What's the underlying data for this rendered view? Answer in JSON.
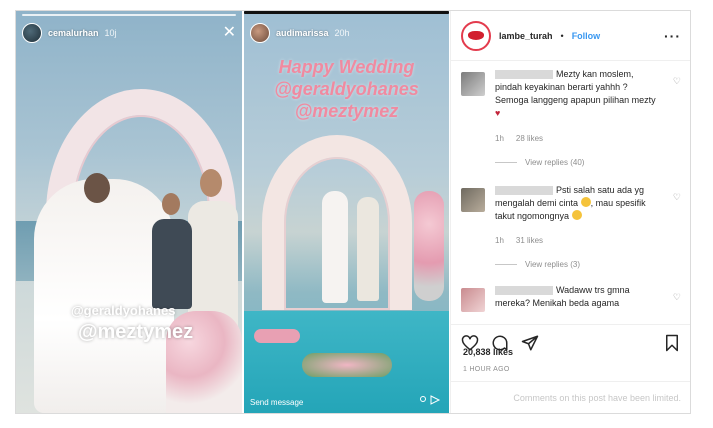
{
  "story_left": {
    "username": "cemalurhan",
    "time": "10j",
    "close_glyph": "✕",
    "tag_handle_1": "@geraldyohanes",
    "tag_handle_2": "@meztymez"
  },
  "story_right": {
    "username": "audimarissa",
    "time": "20h",
    "overlay_line_1": "Happy Wedding",
    "overlay_line_2": "@geraldyohanes",
    "overlay_line_3": "@meztymez",
    "send_message": "Send message"
  },
  "post": {
    "username": "lambe_turah",
    "separator": "•",
    "follow": "Follow",
    "more": "···",
    "comments": [
      {
        "text": "Mezty kan moslem, pindah keyakinan berarti yahhh ? Semoga langgeng apapun pilihan mezty",
        "heart": "♥",
        "time": "1h",
        "likes": "28 likes",
        "replies": "View replies (40)"
      },
      {
        "text": "Psti salah satu ada yg mengalah demi cinta",
        "text_2": ", mau spesifik takut ngomongnya",
        "time": "1h",
        "likes": "31 likes",
        "replies": "View replies (3)"
      },
      {
        "text": "Wadaww trs gmna mereka? Menikah beda agama"
      }
    ],
    "likes": "20,838 likes",
    "ago": "1 HOUR AGO",
    "limited": "Comments on this post have been limited."
  },
  "colors": {
    "accent_blue": "#3897f0",
    "brand_red": "#e33b4d",
    "text_dark": "#262626",
    "text_muted": "#8e8e8e"
  }
}
